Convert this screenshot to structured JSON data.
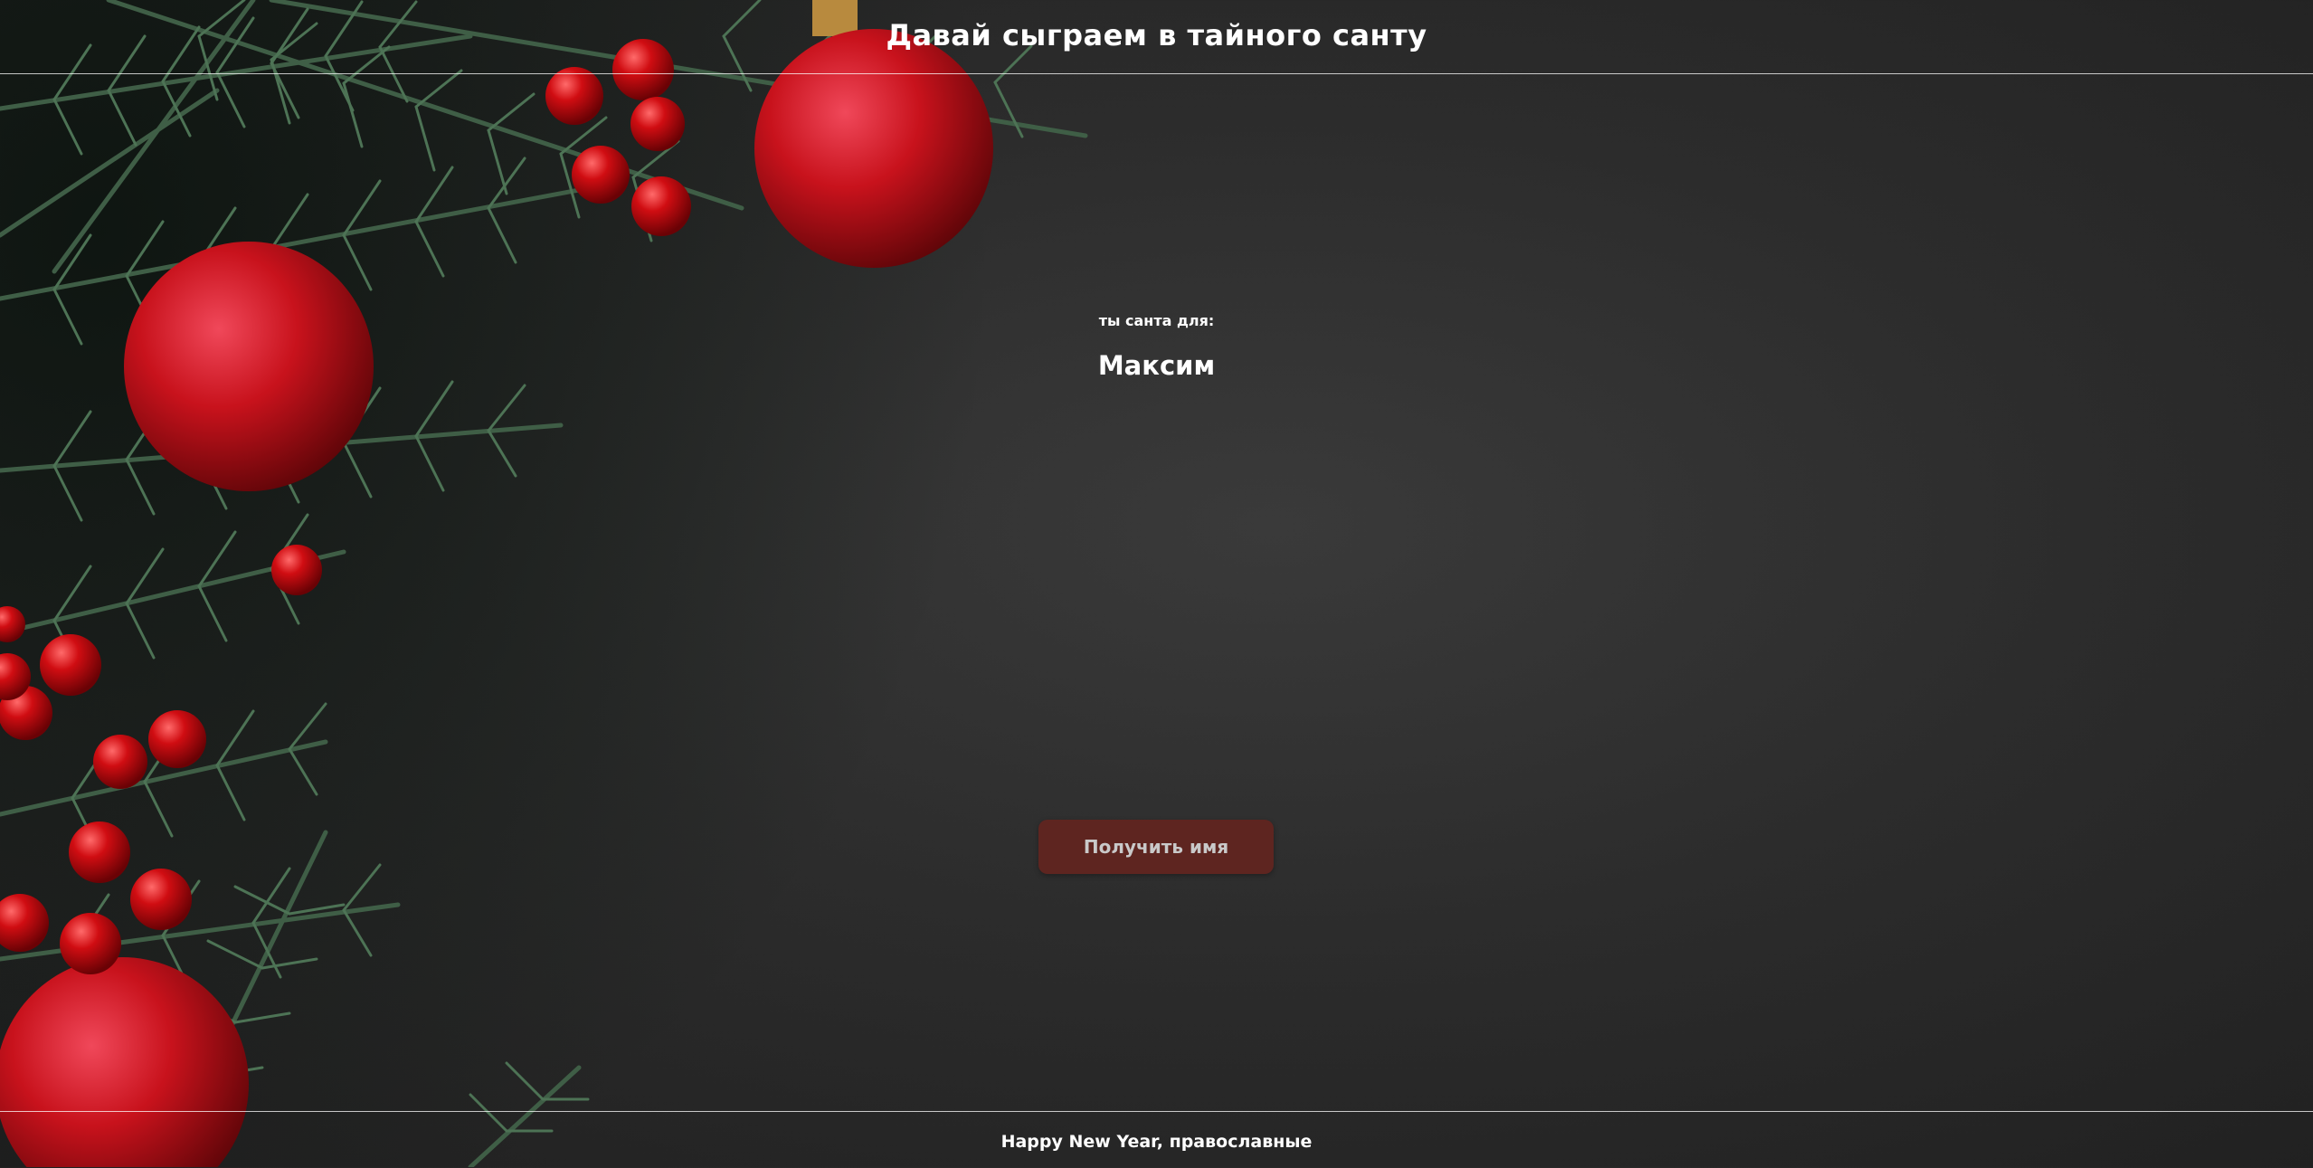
{
  "header": {
    "title": "Давай сыграем в тайного санту"
  },
  "result": {
    "label": "ты санта для:",
    "name": "Максим"
  },
  "actions": {
    "get_name_label": "Получить имя"
  },
  "footer": {
    "text": "Happy New Year, православные"
  },
  "colors": {
    "background": "#2c2c2c",
    "button": "#5e2520",
    "ornament": "#d0151c",
    "pine": "#3f5e46"
  }
}
